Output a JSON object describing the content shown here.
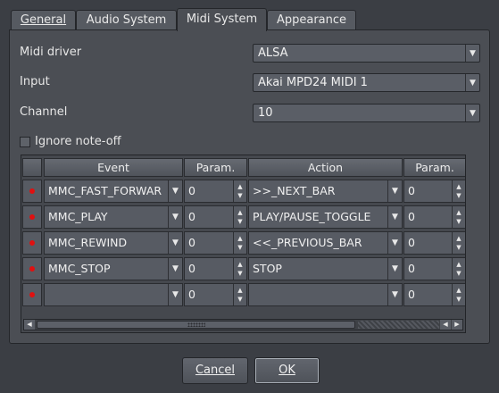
{
  "tabs": [
    {
      "label": "General",
      "active": false
    },
    {
      "label": "Audio System",
      "active": false
    },
    {
      "label": "Midi System",
      "active": true
    },
    {
      "label": "Appearance",
      "active": false
    }
  ],
  "form": {
    "midi_driver_label": "Midi driver",
    "midi_driver_value": "ALSA",
    "input_label": "Input",
    "input_value": "Akai MPD24 MIDI 1",
    "channel_label": "Channel",
    "channel_value": "10",
    "ignore_noteoff_label": "Ignore note-off",
    "ignore_noteoff_checked": false
  },
  "table": {
    "headers": [
      "Event",
      "Param.",
      "Action",
      "Param."
    ],
    "rows": [
      {
        "event": "MMC_FAST_FORWAR",
        "param1": "0",
        "action": ">>_NEXT_BAR",
        "param2": "0"
      },
      {
        "event": "MMC_PLAY",
        "param1": "0",
        "action": "PLAY/PAUSE_TOGGLE",
        "param2": "0"
      },
      {
        "event": "MMC_REWIND",
        "param1": "0",
        "action": "<<_PREVIOUS_BAR",
        "param2": "0"
      },
      {
        "event": "MMC_STOP",
        "param1": "0",
        "action": "STOP",
        "param2": "0"
      },
      {
        "event": "",
        "param1": "0",
        "action": "",
        "param2": "0"
      }
    ]
  },
  "buttons": {
    "cancel": "Cancel",
    "ok": "OK"
  },
  "icons": {
    "dropdown": "chevron-down-icon",
    "spin_up": "spin-up-icon",
    "spin_down": "spin-down-icon",
    "row_marker": "red-dot-icon"
  },
  "colors": {
    "background": "#3b3e44",
    "panel": "#4b4e54",
    "row_marker": "#e01010"
  }
}
